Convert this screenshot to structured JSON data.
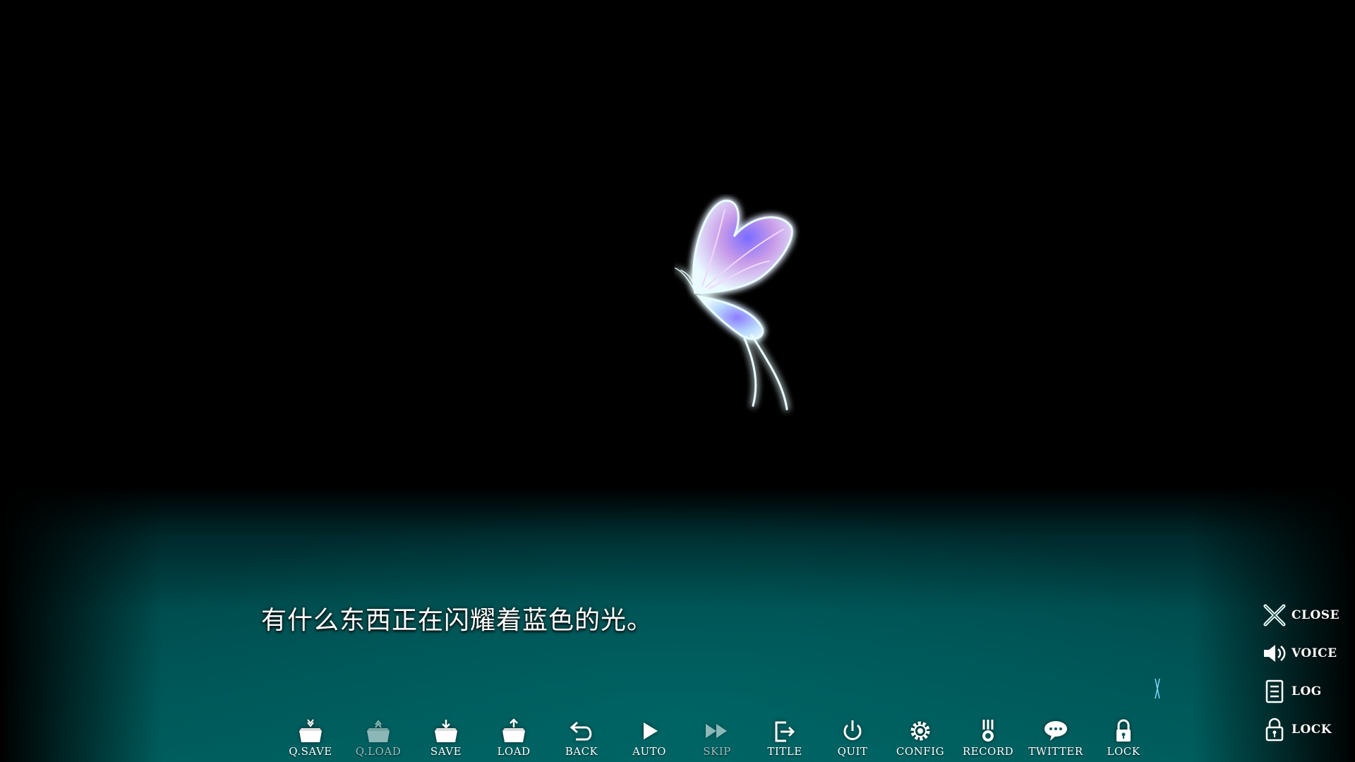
{
  "scene": {
    "dialogue": "有什么东西正在闪耀着蓝色的光。",
    "accent_color": "#005c5c",
    "glow_color": "#7fe8ff"
  },
  "toolbar": {
    "items": [
      {
        "label": "Q.SAVE",
        "icon": "quick-save-icon"
      },
      {
        "label": "Q.LOAD",
        "icon": "quick-load-icon"
      },
      {
        "label": "SAVE",
        "icon": "save-icon"
      },
      {
        "label": "LOAD",
        "icon": "load-icon"
      },
      {
        "label": "BACK",
        "icon": "back-arrow-icon"
      },
      {
        "label": "AUTO",
        "icon": "play-icon"
      },
      {
        "label": "SKIP",
        "icon": "fast-forward-icon"
      },
      {
        "label": "TITLE",
        "icon": "exit-to-title-icon"
      },
      {
        "label": "QUIT",
        "icon": "power-icon"
      },
      {
        "label": "CONFIG",
        "icon": "gear-icon"
      },
      {
        "label": "RECORD",
        "icon": "medal-icon"
      },
      {
        "label": "TWITTER",
        "icon": "speech-bubble-icon"
      },
      {
        "label": "LOCK",
        "icon": "lock-icon"
      }
    ]
  },
  "side_menu": {
    "items": [
      {
        "label": "CLOSE",
        "icon": "close-icon"
      },
      {
        "label": "VOICE",
        "icon": "speaker-icon"
      },
      {
        "label": "LOG",
        "icon": "log-icon"
      },
      {
        "label": "LOCK",
        "icon": "lock-icon"
      }
    ]
  }
}
